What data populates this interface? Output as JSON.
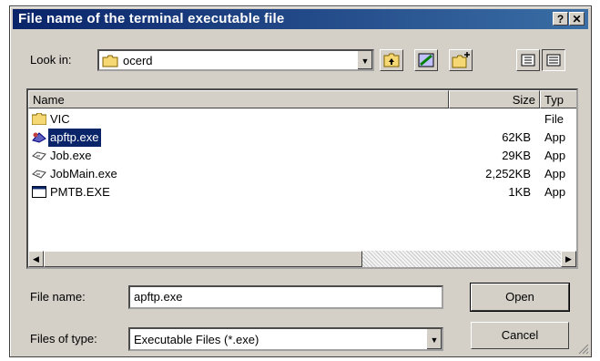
{
  "dialog": {
    "title": "File name of the terminal executable file",
    "help_label": "?",
    "close_label": "✕"
  },
  "look_in": {
    "label": "Look in:",
    "value": "ocerd"
  },
  "list": {
    "columns": {
      "name": "Name",
      "size": "Size",
      "type": "Typ"
    },
    "rows": [
      {
        "name": "VIC",
        "size": "",
        "type": "File",
        "icon": "folder-icon"
      },
      {
        "name": "apftp.exe",
        "size": "62KB",
        "type": "App",
        "icon": "application-icon",
        "selected": true
      },
      {
        "name": "Job.exe",
        "size": "29KB",
        "type": "App",
        "icon": "java-app-icon"
      },
      {
        "name": "JobMain.exe",
        "size": "2,252KB",
        "type": "App",
        "icon": "java-app-icon"
      },
      {
        "name": "PMTB.EXE",
        "size": "1KB",
        "type": "App",
        "icon": "window-app-icon"
      }
    ]
  },
  "file_name": {
    "label": "File name:",
    "value": "apftp.exe"
  },
  "files_of_type": {
    "label": "Files of type:",
    "value": "Executable Files (*.exe)"
  },
  "buttons": {
    "open": "Open",
    "cancel": "Cancel"
  },
  "colors": {
    "titlebar": "#0a246a",
    "selection": "#0a246a",
    "face": "#d4d0c8"
  }
}
